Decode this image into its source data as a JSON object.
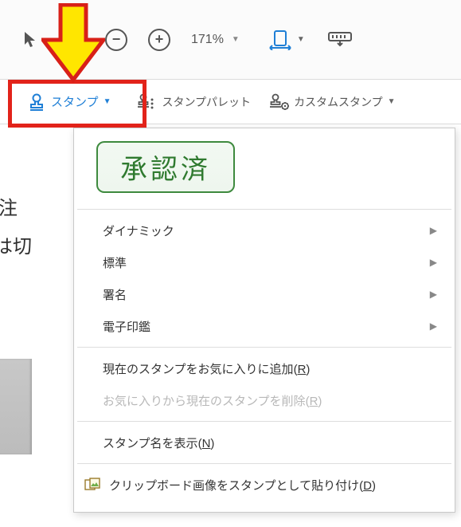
{
  "toolbar": {
    "zoom_value": "171%"
  },
  "stampbar": {
    "stamp_label": "スタンプ",
    "palette_label": "スタンプパレット",
    "custom_label": "カスタムスタンプ"
  },
  "doc_fragment_line1": " 注",
  "doc_fragment_line2": "は切",
  "menu": {
    "approved_text": "承認済",
    "categories": {
      "dynamic": "ダイナミック",
      "standard": "標準",
      "signature": "署名",
      "eseal": "電子印鑑"
    },
    "add_favorite": "現在のスタンプをお気に入りに追加",
    "add_favorite_accel": "R",
    "remove_favorite": "お気に入りから現在のスタンプを削除",
    "remove_favorite_accel": "R",
    "show_names": "スタンプ名を表示",
    "show_names_accel": "N",
    "paste_clipboard": "クリップボード画像をスタンプとして貼り付け",
    "paste_clipboard_accel": "D"
  }
}
